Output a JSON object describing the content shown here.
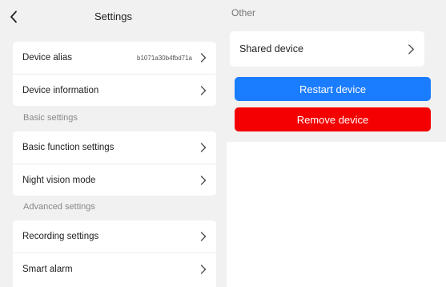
{
  "header": {
    "title": "Settings"
  },
  "left": {
    "card1": [
      {
        "label": "Device alias",
        "value": "b1071a30b4fbd71a"
      },
      {
        "label": "Device information"
      }
    ],
    "basic_section": "Basic settings",
    "card2": [
      {
        "label": "Basic function settings"
      },
      {
        "label": "Night vision mode"
      }
    ],
    "advanced_section": "Advanced settings",
    "card3": [
      {
        "label": "Recording settings"
      },
      {
        "label": "Smart alarm"
      }
    ]
  },
  "right": {
    "other_section": "Other",
    "shared_device": "Shared device",
    "restart_label": "Restart device",
    "remove_label": "Remove device"
  },
  "colors": {
    "restart": "#1a7cff",
    "remove": "#f40000",
    "background": "#f1f1f1"
  }
}
